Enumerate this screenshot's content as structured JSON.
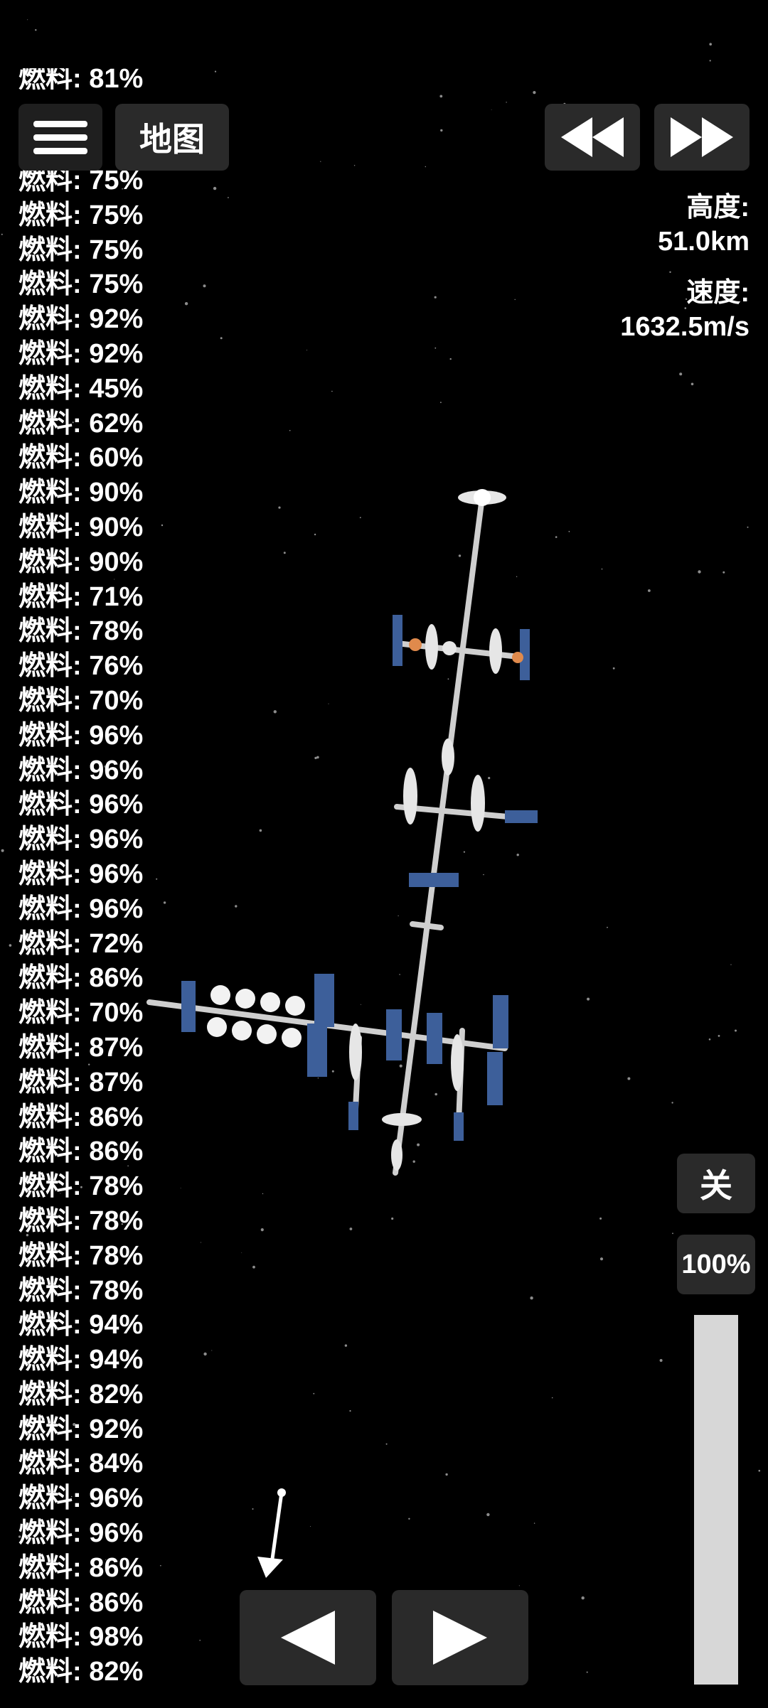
{
  "fuel_label": "燃料",
  "fuel_partial_row": "燃料: 81%",
  "fuel_rows": [
    "燃料: 75%",
    "燃料: 75%",
    "燃料: 75%",
    "燃料: 75%",
    "燃料: 92%",
    "燃料: 92%",
    "燃料: 45%",
    "燃料: 62%",
    "燃料: 60%",
    "燃料: 90%",
    "燃料: 90%",
    "燃料: 90%",
    "燃料: 71%",
    "燃料: 78%",
    "燃料: 76%",
    "燃料: 70%",
    "燃料: 96%",
    "燃料: 96%",
    "燃料: 96%",
    "燃料: 96%",
    "燃料: 96%",
    "燃料: 96%",
    "燃料: 72%",
    "燃料: 86%",
    "燃料: 70%",
    "燃料: 87%",
    "燃料: 87%",
    "燃料: 86%",
    "燃料: 86%",
    "燃料: 78%",
    "燃料: 78%",
    "燃料: 78%",
    "燃料: 78%",
    "燃料: 94%",
    "燃料: 94%",
    "燃料: 82%",
    "燃料: 92%",
    "燃料: 84%",
    "燃料: 96%",
    "燃料: 96%",
    "燃料: 86%",
    "燃料: 86%",
    "燃料: 98%",
    "燃料: 82%"
  ],
  "toolbar": {
    "menu_icon": "hamburger-icon",
    "map_label": "地图",
    "rewind_icon": "rewind-icon",
    "fast_forward_icon": "fast-forward-icon"
  },
  "telemetry": {
    "altitude_label": "高度:",
    "altitude_value": "51.0km",
    "speed_label": "速度:",
    "speed_value": "1632.5m/s"
  },
  "controls": {
    "toggle_label": "关",
    "throttle_label": "100%",
    "throttle_fraction": 1.0,
    "prev_icon": "triangle-left-icon",
    "next_icon": "triangle-right-icon",
    "direction_icon": "direction-arrow-icon"
  },
  "colors": {
    "background": "#000000",
    "button": "#2a2a2a",
    "solar_panel": "#3d5f9a",
    "throttle_fill": "#d7d7d7"
  }
}
